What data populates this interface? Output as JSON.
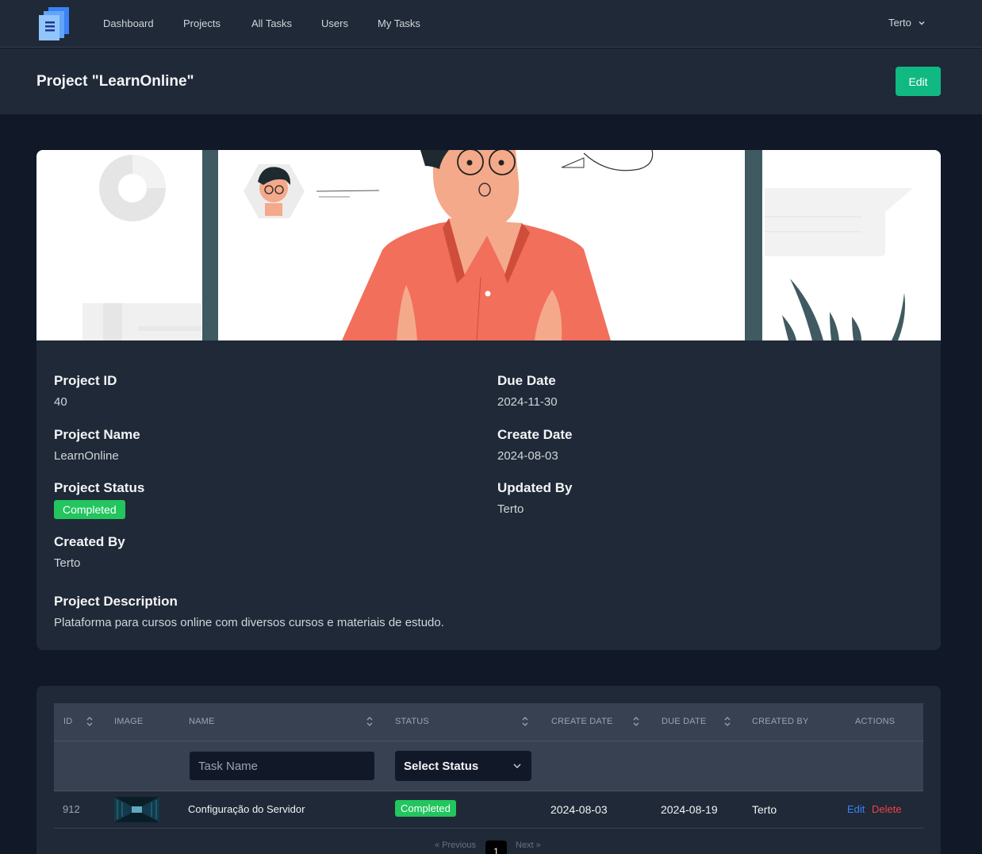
{
  "nav": {
    "links": [
      "Dashboard",
      "Projects",
      "All Tasks",
      "Users",
      "My Tasks"
    ],
    "user": "Terto",
    "logo_icon": "document-stack-icon",
    "chevron_icon": "chevron-down-icon"
  },
  "header": {
    "title": "Project \"LearnOnline\"",
    "edit_label": "Edit"
  },
  "project": {
    "id_label": "Project ID",
    "id_value": "40",
    "name_label": "Project Name",
    "name_value": "LearnOnline",
    "status_label": "Project Status",
    "status_value": "Completed",
    "created_by_label": "Created By",
    "created_by_value": "Terto",
    "due_label": "Due Date",
    "due_value": "2024-11-30",
    "create_label": "Create Date",
    "create_value": "2024-08-03",
    "updated_by_label": "Updated By",
    "updated_by_value": "Terto",
    "description_label": "Project Description",
    "description_value": "Plataforma para cursos online com diversos cursos e materiais de estudo."
  },
  "table": {
    "headers": [
      "ID",
      "IMAGE",
      "NAME",
      "STATUS",
      "CREATE DATE",
      "DUE DATE",
      "CREATED BY",
      "ACTIONS"
    ],
    "search_placeholder": "Task Name",
    "select_label": "Select Status",
    "rows": [
      {
        "id": "912",
        "name": "Configuração do Servidor",
        "status": "Completed",
        "create_date": "2024-08-03",
        "due_date": "2024-08-19",
        "created_by": "Terto",
        "edit": "Edit",
        "delete": "Delete"
      }
    ],
    "pagination": {
      "prev": "« Previous",
      "current": "1",
      "next": "Next »"
    }
  },
  "colors": {
    "background": "#111827",
    "surface": "#1f2937",
    "accent": "#10b981",
    "status_completed": "#22c55e",
    "link_edit": "#3b82f6",
    "link_delete": "#ef4444"
  }
}
